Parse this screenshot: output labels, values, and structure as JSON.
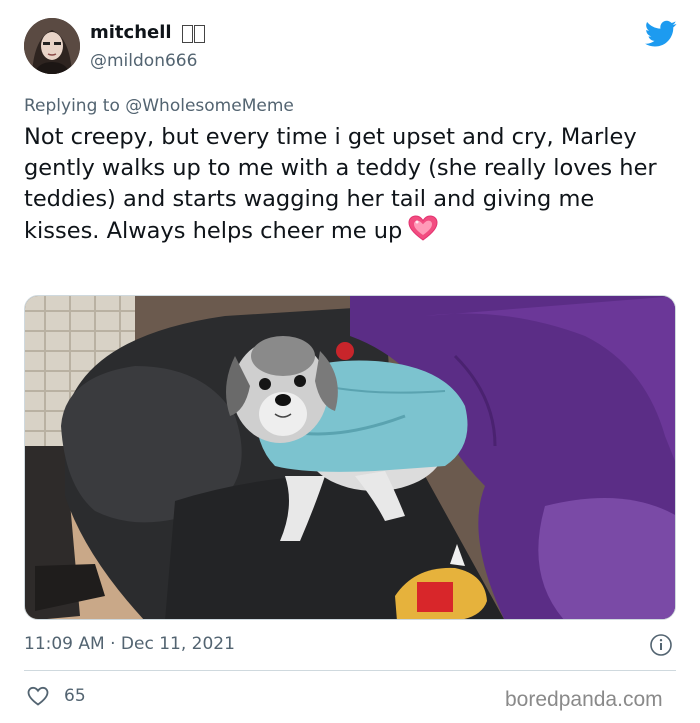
{
  "author": {
    "display_name": "mitchell",
    "handle": "@mildon666",
    "verified": false
  },
  "brand": {
    "icon": "twitter-bird-icon",
    "color": "#1d9bf0"
  },
  "reply": {
    "prefix": "Replying to",
    "mention": "@WholesomeMeme"
  },
  "tweet": {
    "text": "Not creepy, but every time i get upset and cry, Marley gently walks up to me with a teddy (she really loves her teddies) and starts wagging her tail and giving me kisses. Always helps cheer me up",
    "emoji": "sparkling-heart-icon"
  },
  "media": {
    "icon": "photo-dog-in-sweater"
  },
  "meta": {
    "timestamp": "11:09 AM · Dec 11, 2021",
    "info_icon": "info-icon"
  },
  "engagement": {
    "like_icon": "heart-outline-icon",
    "likes": "65"
  },
  "watermark": "boredpanda.com"
}
